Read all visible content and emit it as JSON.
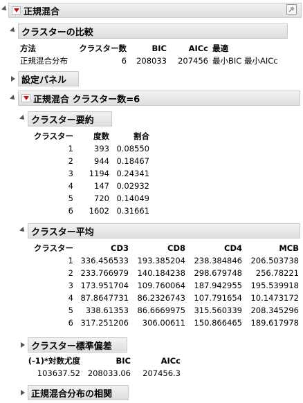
{
  "report": {
    "title": "正規混合",
    "compare": {
      "title": "クラスターの比較",
      "headers": [
        "方法",
        "クラスター数",
        "BIC",
        "AICc",
        "最適"
      ],
      "row": [
        "正規混合分布",
        "6",
        "208033",
        "207456",
        "最小BIC 最小AICc"
      ]
    },
    "settings": {
      "title": "設定パネル"
    },
    "model": {
      "title": "正規混合 クラスター数=6",
      "summary": {
        "title": "クラスター要約",
        "headers": [
          "クラスター",
          "度数",
          "割合"
        ],
        "rows": [
          [
            "1",
            "393",
            "0.08550"
          ],
          [
            "2",
            "944",
            "0.18467"
          ],
          [
            "3",
            "1194",
            "0.24341"
          ],
          [
            "4",
            "147",
            "0.02932"
          ],
          [
            "5",
            "720",
            "0.14049"
          ],
          [
            "6",
            "1602",
            "0.31661"
          ]
        ]
      },
      "means": {
        "title": "クラスター平均",
        "headers": [
          "クラスター",
          "CD3",
          "CD8",
          "CD4",
          "MCB"
        ],
        "rows": [
          [
            "1",
            "336.456533",
            "193.385204",
            "238.384846",
            "206.503738"
          ],
          [
            "2",
            "233.766979",
            "140.184238",
            "298.679748",
            "256.78221"
          ],
          [
            "3",
            "173.951704",
            "109.760064",
            "187.942955",
            "195.539918"
          ],
          [
            "4",
            "87.8647731",
            "86.2326743",
            "107.791654",
            "10.1473172"
          ],
          [
            "5",
            "338.61353",
            "86.6669975",
            "315.560339",
            "208.345296"
          ],
          [
            "6",
            "317.251206",
            "306.00611",
            "150.866465",
            "189.617978"
          ]
        ]
      },
      "stddev": {
        "title": "クラスター標準偏差"
      },
      "fit": {
        "headers": [
          "(-1)*対数尤度",
          "BIC",
          "AICc"
        ],
        "row": [
          "103637.52",
          "208033.06",
          "207456.3"
        ]
      },
      "corr": {
        "title": "正規混合分布の相関"
      }
    }
  }
}
